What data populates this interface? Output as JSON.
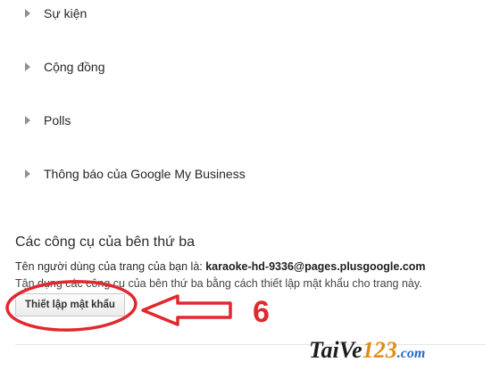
{
  "sections": [
    {
      "label": "Sự kiện"
    },
    {
      "label": "Cộng đồng"
    },
    {
      "label": "Polls"
    },
    {
      "label": "Thông báo của Google My Business"
    }
  ],
  "third_party": {
    "heading": "Các công cụ của bên thứ ba",
    "username_prefix": "Tên người dùng của trang của bạn là: ",
    "username": "karaoke-hd-9336@pages.plusgoogle.com",
    "description": "Tận dụng các công cụ của bên thứ ba bằng cách thiết lập mật khẩu cho trang này.",
    "button_label": "Thiết lập mật khẩu"
  },
  "annotation": {
    "step_number": "6",
    "color": "#e0282e"
  },
  "watermark": {
    "part1": "TaiVe",
    "part2": "123",
    "part3": ".com"
  }
}
